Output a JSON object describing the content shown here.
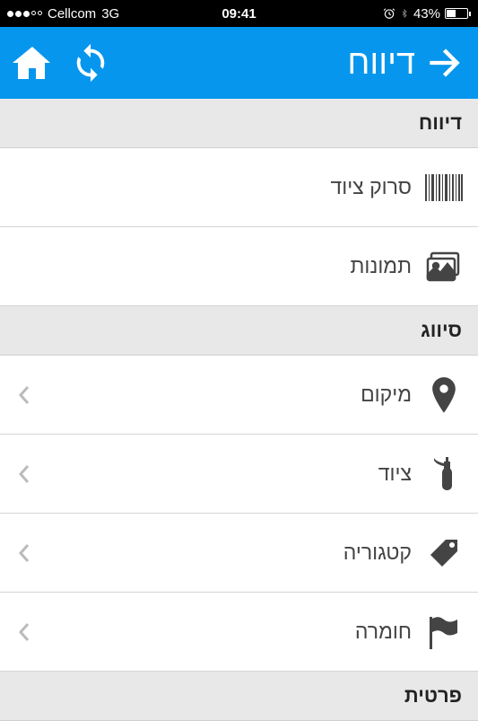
{
  "statusBar": {
    "carrier": "Cellcom",
    "network": "3G",
    "time": "09:41",
    "battery": "43%"
  },
  "navBar": {
    "title": "דיווח"
  },
  "sections": [
    {
      "header": "דיווח",
      "items": [
        {
          "label": "סרוק ציוד",
          "hasChevron": false
        },
        {
          "label": "תמונות",
          "hasChevron": false
        }
      ]
    },
    {
      "header": "סיווג",
      "items": [
        {
          "label": "מיקום",
          "hasChevron": true
        },
        {
          "label": "ציוד",
          "hasChevron": true
        },
        {
          "label": "קטגוריה",
          "hasChevron": true
        },
        {
          "label": "חומרה",
          "hasChevron": true
        }
      ]
    },
    {
      "header": "פרטית",
      "items": []
    }
  ]
}
